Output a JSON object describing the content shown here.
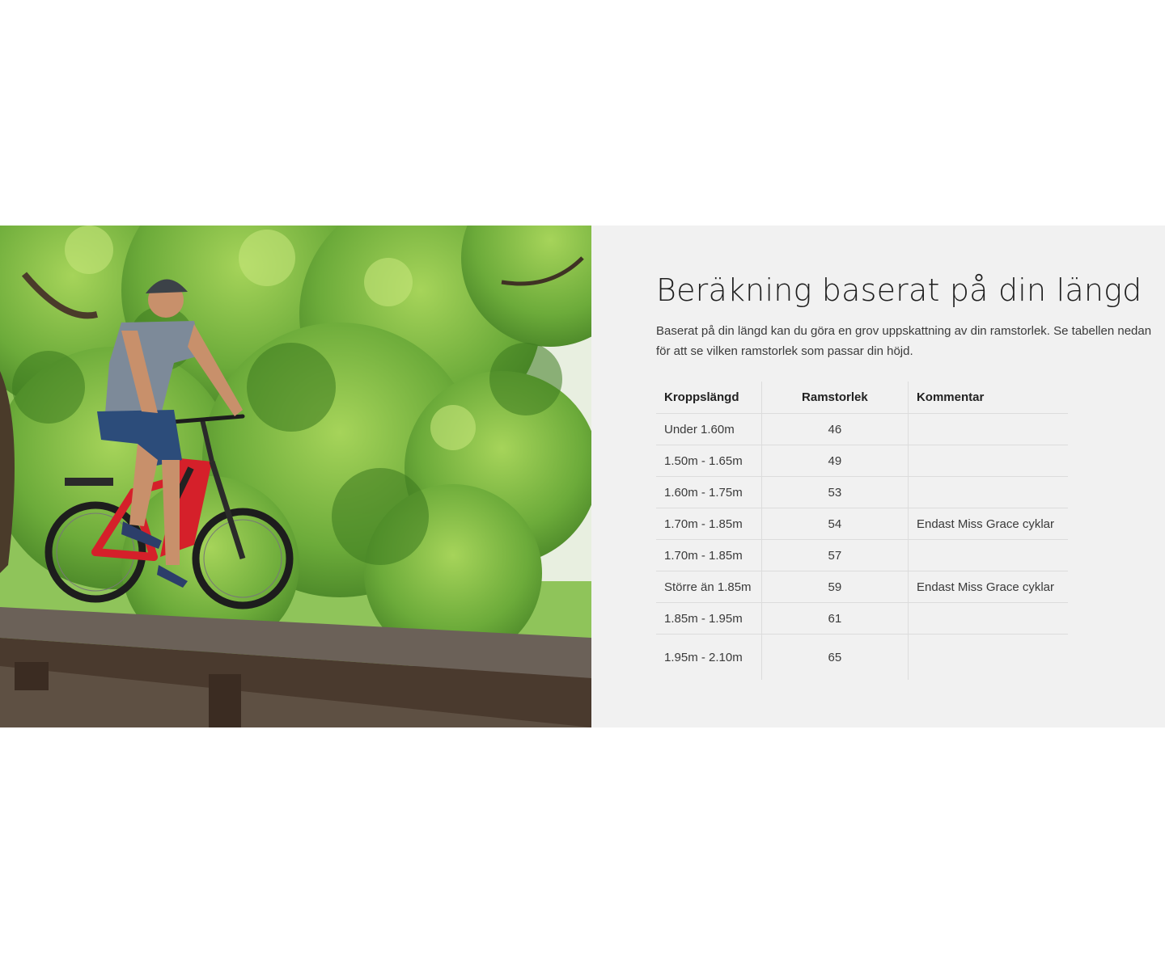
{
  "hero_image": {
    "alt_subject": "cyclist-on-red-ebike-on-boardwalk"
  },
  "section": {
    "heading": "Beräkning baserat på din längd",
    "intro": "Baserat på din längd kan du göra en grov uppskattning av din ramstorlek. Se tabellen nedan för att se vilken ramstorlek som passar din höjd."
  },
  "table": {
    "headers": {
      "height": "Kroppslängd",
      "frame": "Ramstorlek",
      "comment": "Kommentar"
    },
    "rows": [
      {
        "height": "Under 1.60m",
        "frame": "46",
        "comment": ""
      },
      {
        "height": "1.50m - 1.65m",
        "frame": "49",
        "comment": ""
      },
      {
        "height": "1.60m - 1.75m",
        "frame": "53",
        "comment": ""
      },
      {
        "height": "1.70m - 1.85m",
        "frame": "54",
        "comment": "Endast Miss Grace cyklar"
      },
      {
        "height": "1.70m - 1.85m",
        "frame": "57",
        "comment": ""
      },
      {
        "height": "Större än 1.85m",
        "frame": "59",
        "comment": "Endast Miss Grace cyklar"
      },
      {
        "height": "1.85m - 1.95m",
        "frame": "61",
        "comment": ""
      },
      {
        "height": "1.95m - 2.10m",
        "frame": "65",
        "comment": ""
      }
    ]
  },
  "colors": {
    "panel_bg": "#f1f1f1",
    "foliage": "#6cab3a",
    "bike_red": "#d5202a",
    "boardwalk": "#5a4f47"
  }
}
